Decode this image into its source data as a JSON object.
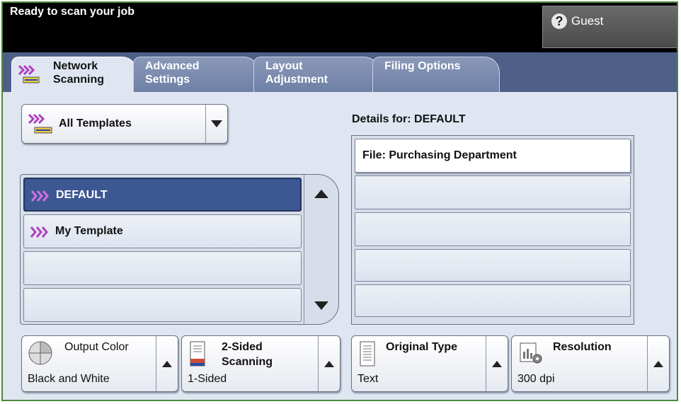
{
  "status": {
    "message": "Ready to scan your job"
  },
  "user": {
    "label": "Guest",
    "icon": "help-question-icon"
  },
  "tabs": [
    {
      "line1": "Network",
      "line2": "Scanning",
      "active": true
    },
    {
      "line1": "Advanced",
      "line2": "Settings",
      "active": false
    },
    {
      "line1": "Layout",
      "line2": "Adjustment",
      "active": false
    },
    {
      "line1": "Filing Options",
      "line2": "",
      "active": false
    }
  ],
  "templates": {
    "dropdown_value": "All Templates",
    "items": [
      {
        "label": "DEFAULT",
        "selected": true
      },
      {
        "label": "My Template",
        "selected": false
      },
      {
        "label": "",
        "selected": false
      },
      {
        "label": "",
        "selected": false
      }
    ]
  },
  "details": {
    "heading": "Details for: DEFAULT",
    "rows": [
      "File: Purchasing Department",
      "",
      "",
      "",
      ""
    ]
  },
  "options": {
    "output_color": {
      "title": "Output Color",
      "value": "Black and White"
    },
    "two_sided": {
      "title_line1": "2-Sided",
      "title_line2": "Scanning",
      "value": "1-Sided"
    },
    "original_type": {
      "title": "Original Type",
      "value": "Text"
    },
    "resolution": {
      "title": "Resolution",
      "value": "300 dpi"
    }
  },
  "colors": {
    "accent": "#3d5792",
    "tabstrip": "#4e6088",
    "panel": "#dfe6f2",
    "template_icon": "#b040c0"
  }
}
